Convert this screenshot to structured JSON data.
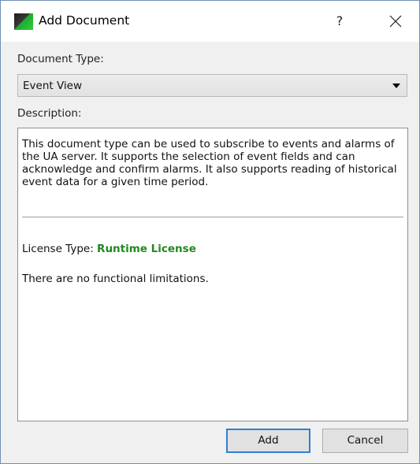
{
  "window": {
    "title": "Add Document",
    "help_label": "?",
    "close_label": "Close"
  },
  "document_type": {
    "label": "Document Type:",
    "selected": "Event View"
  },
  "description": {
    "label": "Description:",
    "text": "This document type can be used to subscribe to events and alarms of the UA server. It supports the selection of event fields and can acknowledge and confirm alarms. It also supports reading of historical event data for a given time period.",
    "license_label": "License Type:",
    "license_value": "Runtime License",
    "limitations": "There are no functional limitations."
  },
  "buttons": {
    "add": "Add",
    "cancel": "Cancel"
  },
  "colors": {
    "license_value": "#1e8a1e",
    "default_button_border": "#2f7fd0"
  }
}
